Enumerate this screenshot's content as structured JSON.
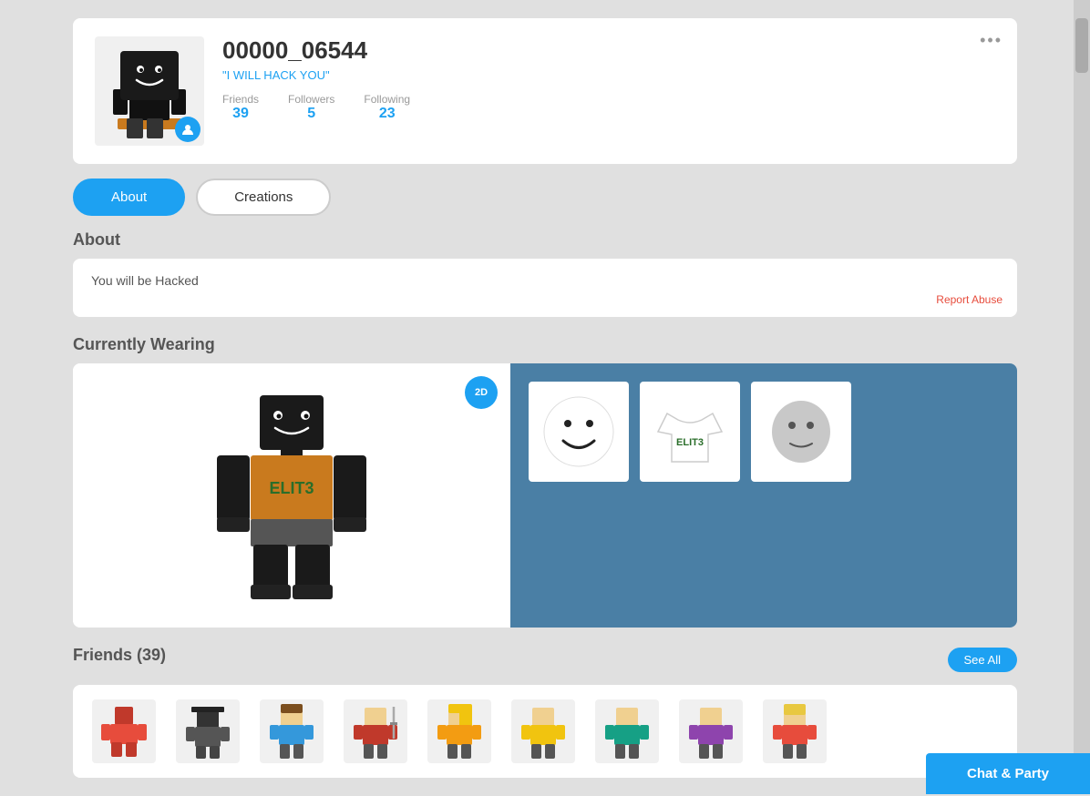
{
  "profile": {
    "username": "00000_06544",
    "status": "\"I WILL HACK YOU\"",
    "friends_label": "Friends",
    "friends_count": "39",
    "followers_label": "Followers",
    "followers_count": "5",
    "following_label": "Following",
    "following_count": "23"
  },
  "tabs": {
    "about_label": "About",
    "creations_label": "Creations"
  },
  "about": {
    "section_title": "About",
    "description": "You will be Hacked",
    "report_abuse_label": "Report Abuse"
  },
  "wearing": {
    "section_title": "Currently Wearing",
    "toggle_label": "2D"
  },
  "friends": {
    "section_title": "Friends (39)",
    "see_all_label": "See All"
  },
  "chat_bar": {
    "label": "Chat & Party"
  },
  "more_button": "•••"
}
